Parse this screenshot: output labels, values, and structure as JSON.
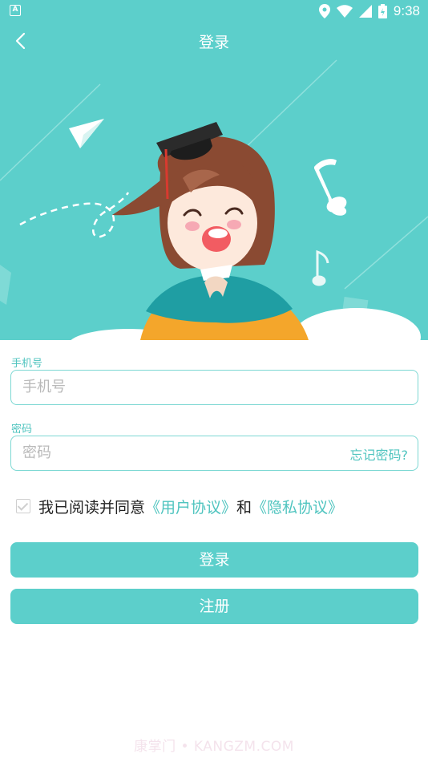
{
  "status_bar": {
    "left_icon": "A",
    "icons": [
      "location-icon",
      "wifi-icon",
      "signal-icon",
      "battery-icon"
    ],
    "time": "9:38"
  },
  "nav": {
    "title": "登录",
    "back_icon": "chevron-left-icon"
  },
  "form": {
    "phone": {
      "label": "手机号",
      "placeholder": "手机号",
      "value": ""
    },
    "password": {
      "label": "密码",
      "placeholder": "密码",
      "value": "",
      "forgot": "忘记密码?"
    },
    "agreement": {
      "checked": false,
      "prefix": "我已阅读并同意",
      "user_agreement": "《用户协议》",
      "and": "和",
      "privacy_agreement": "《隐私协议》"
    }
  },
  "buttons": {
    "login": "登录",
    "register": "注册"
  },
  "watermark": "康掌门 • KANGZM.COM",
  "colors": {
    "accent": "#5ccfcb",
    "accent_text": "#4fc4bf",
    "hat": "#2b2b2b",
    "hair": "#8a4a32",
    "shirt_teal": "#1f9ea3",
    "shirt_orange": "#f4a62b"
  }
}
